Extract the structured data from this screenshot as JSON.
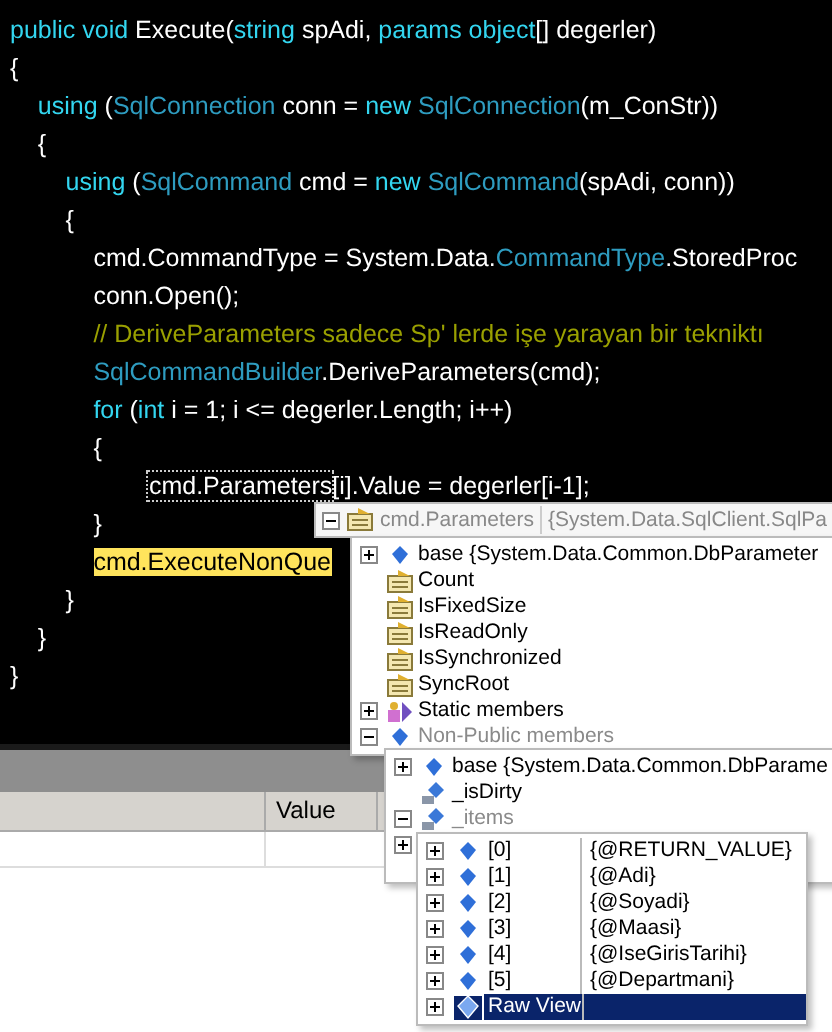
{
  "editor": {
    "lines": [
      {
        "tokens": [
          {
            "kind": "kw",
            "text": "public void "
          },
          {
            "kind": "plain",
            "text": "Execute("
          },
          {
            "kind": "kw",
            "text": "string "
          },
          {
            "kind": "plain",
            "text": "spAdi, "
          },
          {
            "kind": "kw",
            "text": "params object"
          },
          {
            "kind": "plain",
            "text": "[] degerler)"
          }
        ]
      },
      {
        "tokens": [
          {
            "kind": "plain",
            "text": "{"
          }
        ]
      },
      {
        "tokens": [
          {
            "kind": "kw",
            "text": "    using "
          },
          {
            "kind": "plain",
            "text": "("
          },
          {
            "kind": "type",
            "text": "SqlConnection "
          },
          {
            "kind": "plain",
            "text": "conn = "
          },
          {
            "kind": "kw",
            "text": "new "
          },
          {
            "kind": "type",
            "text": "SqlConnection"
          },
          {
            "kind": "plain",
            "text": "(m_ConStr))"
          }
        ]
      },
      {
        "tokens": [
          {
            "kind": "plain",
            "text": "    {"
          }
        ]
      },
      {
        "tokens": [
          {
            "kind": "kw",
            "text": "        using "
          },
          {
            "kind": "plain",
            "text": "("
          },
          {
            "kind": "type",
            "text": "SqlCommand "
          },
          {
            "kind": "plain",
            "text": "cmd = "
          },
          {
            "kind": "kw",
            "text": "new "
          },
          {
            "kind": "type",
            "text": "SqlCommand"
          },
          {
            "kind": "plain",
            "text": "(spAdi, conn))"
          }
        ]
      },
      {
        "tokens": [
          {
            "kind": "plain",
            "text": "        {"
          }
        ]
      },
      {
        "tokens": [
          {
            "kind": "plain",
            "text": "            cmd.CommandType = System.Data."
          },
          {
            "kind": "type",
            "text": "CommandType"
          },
          {
            "kind": "plain",
            "text": ".StoredProc"
          }
        ]
      },
      {
        "tokens": [
          {
            "kind": "plain",
            "text": "            conn.Open();"
          }
        ]
      },
      {
        "tokens": [
          {
            "kind": "comment",
            "text": "            // DeriveParameters sadece Sp' lerde işe yarayan bir tekniktı"
          }
        ]
      },
      {
        "tokens": [
          {
            "kind": "type",
            "text": "            SqlCommandBuilder"
          },
          {
            "kind": "plain",
            "text": ".DeriveParameters(cmd);"
          }
        ]
      },
      {
        "tokens": [
          {
            "kind": "kw",
            "text": "            for "
          },
          {
            "kind": "plain",
            "text": "("
          },
          {
            "kind": "kw",
            "text": "int "
          },
          {
            "kind": "plain",
            "text": "i = 1; i <= degerler.Length; i++)"
          }
        ]
      },
      {
        "tokens": [
          {
            "kind": "plain",
            "text": "            {"
          }
        ]
      },
      {
        "tokens": [
          {
            "kind": "hover",
            "text": "                    cmd.Parameters"
          },
          {
            "kind": "plain",
            "text": "[i].Value = degerler[i-1];"
          }
        ]
      },
      {
        "tokens": [
          {
            "kind": "plain",
            "text": "            }"
          }
        ]
      },
      {
        "tokens": [
          {
            "kind": "current",
            "text": "            cmd.ExecuteNonQue"
          }
        ]
      },
      {
        "tokens": [
          {
            "kind": "plain",
            "text": "        }"
          }
        ]
      },
      {
        "tokens": [
          {
            "kind": "plain",
            "text": "    }"
          }
        ]
      },
      {
        "tokens": [
          {
            "kind": "plain",
            "text": "}"
          }
        ]
      }
    ]
  },
  "datatip": {
    "expression": "cmd.Parameters",
    "value": "{System.Data.SqlClient.SqlPa",
    "kind": "property",
    "expandable": true,
    "expanded": true,
    "children": [
      {
        "kind": "field",
        "name": "base {System.Data.Common.DbParameter",
        "expandable": true,
        "expanded": false,
        "greyed": false
      },
      {
        "kind": "property",
        "name": "Count",
        "expandable": false,
        "greyed": false
      },
      {
        "kind": "property",
        "name": "IsFixedSize",
        "expandable": false,
        "greyed": false
      },
      {
        "kind": "property",
        "name": "IsReadOnly",
        "expandable": false,
        "greyed": false
      },
      {
        "kind": "property",
        "name": "IsSynchronized",
        "expandable": false,
        "greyed": false
      },
      {
        "kind": "property",
        "name": "SyncRoot",
        "expandable": false,
        "greyed": false
      },
      {
        "kind": "static",
        "name": "Static members",
        "expandable": true,
        "expanded": false,
        "greyed": false
      },
      {
        "kind": "field",
        "name": "Non-Public members",
        "expandable": true,
        "expanded": true,
        "greyed": true,
        "children": [
          {
            "kind": "field",
            "name": "base {System.Data.Common.DbParame",
            "expandable": true,
            "expanded": false,
            "greyed": false
          },
          {
            "kind": "private",
            "name": "_isDirty",
            "expandable": false,
            "greyed": false
          },
          {
            "kind": "private",
            "name": "_items",
            "expandable": true,
            "expanded": true,
            "greyed": true,
            "children": [
              {
                "kind": "field",
                "name": "[0]",
                "value": "{@RETURN_VALUE}",
                "expandable": true,
                "expanded": false,
                "selected": false
              },
              {
                "kind": "field",
                "name": "[1]",
                "value": "{@Adi}",
                "expandable": true,
                "expanded": false,
                "selected": false
              },
              {
                "kind": "field",
                "name": "[2]",
                "value": "{@Soyadi}",
                "expandable": true,
                "expanded": false,
                "selected": false
              },
              {
                "kind": "field",
                "name": "[3]",
                "value": "{@Maasi}",
                "expandable": true,
                "expanded": false,
                "selected": false
              },
              {
                "kind": "field",
                "name": "[4]",
                "value": "{@IseGirisTarihi}",
                "expandable": true,
                "expanded": false,
                "selected": false
              },
              {
                "kind": "field",
                "name": "[5]",
                "value": "{@Departmani}",
                "expandable": true,
                "expanded": false,
                "selected": false
              },
              {
                "kind": "raw",
                "name": "Raw View",
                "expandable": true,
                "expanded": false,
                "selected": true
              }
            ]
          },
          {
            "expandable": true,
            "expanded": false
          }
        ]
      }
    ]
  },
  "locals_panel": {
    "columns": [
      {
        "label": "Value"
      }
    ]
  }
}
